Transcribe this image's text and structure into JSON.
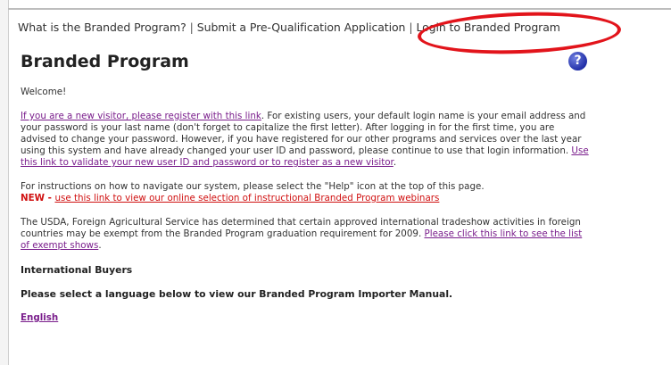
{
  "nav": {
    "items": [
      "What is the Branded Program?",
      "Submit a Pre-Qualification Application",
      "Login to Branded Program"
    ],
    "separator": "|"
  },
  "highlight": {
    "color": "#e2141b",
    "target": "Login to Branded Program"
  },
  "page": {
    "title": "Branded Program",
    "help_icon": "help-question-icon",
    "help_glyph": "?"
  },
  "welcome": "Welcome!",
  "intro": {
    "link1": "If you are a new visitor, please register with this link",
    "text1": ". For existing users, your default login name is your email address and your password is your last name (don't forget to capitalize the first letter). After logging in for the first time, you are advised to change your password. However, if you have registered for our other programs and services over the last year using this system and have already changed your user ID and password, please continue to use that login information. ",
    "link2": "Use this link to validate your new user ID and password or to register as a new visitor",
    "text2": "."
  },
  "instructions": {
    "text": "For instructions on how to navigate our system, please select the \"Help\" icon at the top of this page.",
    "new_tag": "NEW",
    "dash": " - ",
    "link": "use this link to view our online selection of instructional Branded Program webinars"
  },
  "usda": {
    "text": "The USDA, Foreign Agricultural Service has determined that certain approved international tradeshow activities in foreign countries may be exempt from the Branded Program graduation requirement for 2009. ",
    "link": "Please click this link to see the list of exempt shows",
    "text_end": "."
  },
  "buyers": {
    "heading": "International Buyers",
    "prompt": "Please select a language below to view our Branded Program Importer Manual.",
    "languages": [
      "English"
    ]
  }
}
